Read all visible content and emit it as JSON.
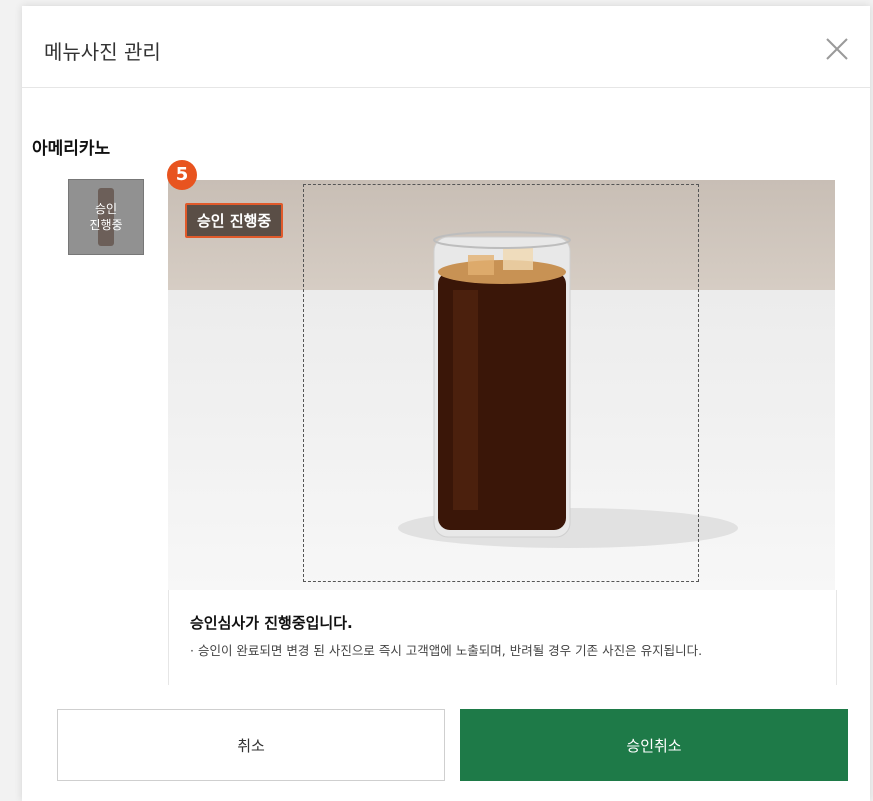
{
  "modal": {
    "title": "메뉴사진 관리",
    "close_icon": "close-icon"
  },
  "menu": {
    "name": "아메리카노",
    "thumbnail": {
      "status_line1": "승인",
      "status_line2": "진행중"
    }
  },
  "photo": {
    "status_badge": "승인 진행중",
    "step_marker": "5"
  },
  "notice": {
    "title": "승인심사가 진행중입니다.",
    "text": "· 승인이 완료되면 변경 된 사진으로 즉시 고객앱에 노출되며, 반려될 경우 기존 사진은 유지됩니다."
  },
  "buttons": {
    "cancel": "취소",
    "cancel_approval": "승인취소"
  },
  "colors": {
    "accent_green": "#1e7a48",
    "step_orange": "#e8541f"
  }
}
